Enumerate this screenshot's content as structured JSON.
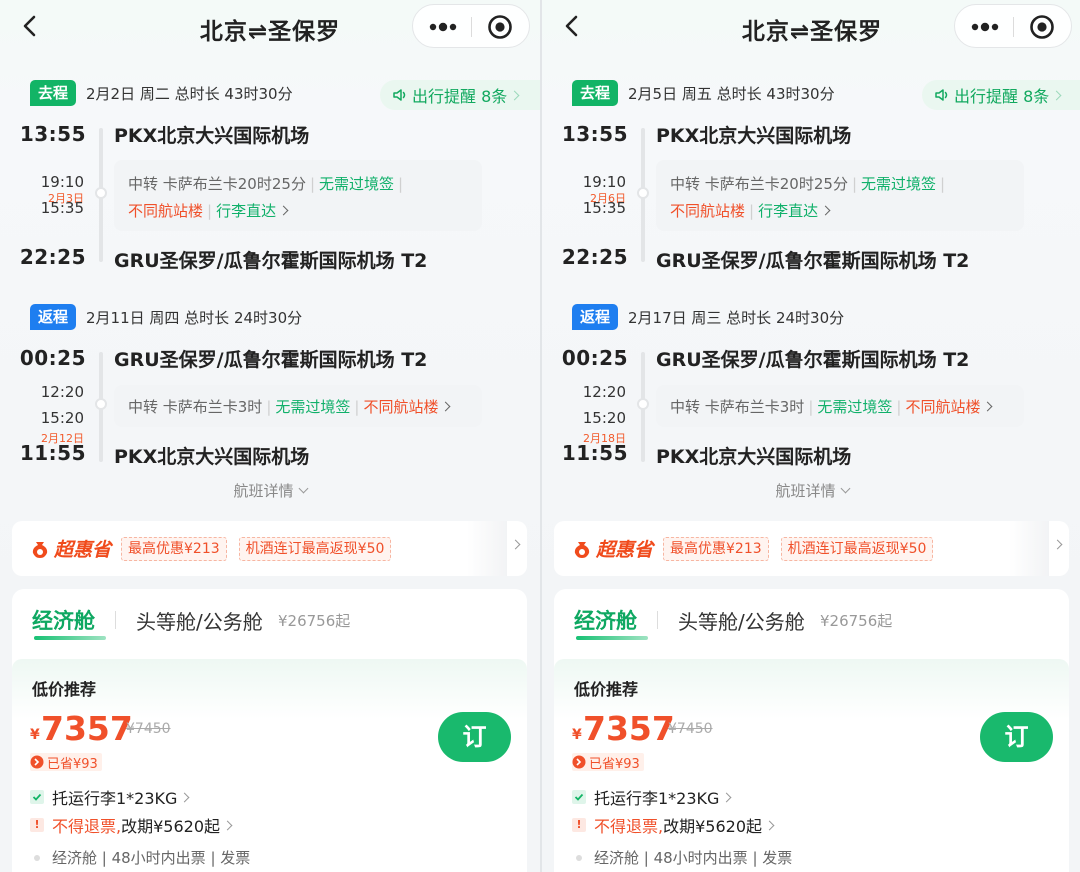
{
  "panels": [
    {
      "header": {
        "title": "北京⇌圣保罗"
      },
      "reminder": "出行提醒 8条",
      "outbound": {
        "tag": "去程",
        "info": "2月2日  周二   总时长 43时30分",
        "depart_time": "13:55",
        "depart_airport": "PKX北京大兴国际机场",
        "transfer_arrive": "19:10",
        "transfer_date": "2月3日",
        "transfer_depart": "15:35",
        "transfer_line1": "中转 卡萨布兰卡20时25分",
        "transfer_tag1": "无需过境签",
        "transfer_tag2": "不同航站楼",
        "transfer_tag3": "行李直达",
        "arrive_time": "22:25",
        "arrive_airport": "GRU圣保罗/瓜鲁尔霍斯国际机场 T2"
      },
      "inbound": {
        "tag": "返程",
        "info": "2月11日  周四   总时长 24时30分",
        "depart_time": "00:25",
        "depart_airport": "GRU圣保罗/瓜鲁尔霍斯国际机场 T2",
        "transfer_arrive": "12:20",
        "transfer_depart": "15:20",
        "transfer_line1": "中转 卡萨布兰卡3时",
        "transfer_tag1": "无需过境签",
        "transfer_tag2": "不同航站楼",
        "arrive_date": "2月12日",
        "arrive_time": "11:55",
        "arrive_airport": "PKX北京大兴国际机场"
      },
      "detail_link": "航班详情",
      "promo": {
        "logo": "超惠省",
        "coupon1": "最高优惠¥213",
        "coupon2": "机酒连订最高返现¥50"
      },
      "fares": {
        "tab_economy": "经济舱",
        "tab_first": "头等舱/公务舱",
        "tab_first_price": "¥26756起",
        "card_tag": "低价推荐",
        "currency": "¥",
        "price": "7357",
        "price_old": "¥7450",
        "saved": "已省¥93",
        "book": "订",
        "feature1": "托运行李1*23KG",
        "feature2_red": "不得退票,",
        "feature2_rest": "改期¥5620起",
        "feature3": "经济舱 | 48小时内出票 | 发票"
      }
    },
    {
      "header": {
        "title": "北京⇌圣保罗"
      },
      "reminder": "出行提醒 8条",
      "outbound": {
        "tag": "去程",
        "info": "2月5日  周五   总时长 43时30分",
        "depart_time": "13:55",
        "depart_airport": "PKX北京大兴国际机场",
        "transfer_arrive": "19:10",
        "transfer_date": "2月6日",
        "transfer_depart": "15:35",
        "transfer_line1": "中转 卡萨布兰卡20时25分",
        "transfer_tag1": "无需过境签",
        "transfer_tag2": "不同航站楼",
        "transfer_tag3": "行李直达",
        "arrive_time": "22:25",
        "arrive_airport": "GRU圣保罗/瓜鲁尔霍斯国际机场 T2"
      },
      "inbound": {
        "tag": "返程",
        "info": "2月17日  周三   总时长 24时30分",
        "depart_time": "00:25",
        "depart_airport": "GRU圣保罗/瓜鲁尔霍斯国际机场 T2",
        "transfer_arrive": "12:20",
        "transfer_depart": "15:20",
        "transfer_line1": "中转 卡萨布兰卡3时",
        "transfer_tag1": "无需过境签",
        "transfer_tag2": "不同航站楼",
        "arrive_date": "2月18日",
        "arrive_time": "11:55",
        "arrive_airport": "PKX北京大兴国际机场"
      },
      "detail_link": "航班详情",
      "promo": {
        "logo": "超惠省",
        "coupon1": "最高优惠¥213",
        "coupon2": "机酒连订最高返现¥50"
      },
      "fares": {
        "tab_economy": "经济舱",
        "tab_first": "头等舱/公务舱",
        "tab_first_price": "¥26756起",
        "card_tag": "低价推荐",
        "currency": "¥",
        "price": "7357",
        "price_old": "¥7450",
        "saved": "已省¥93",
        "book": "订",
        "feature1": "托运行李1*23KG",
        "feature2_red": "不得退票,",
        "feature2_rest": "改期¥5620起",
        "feature3": "经济舱 | 48小时内出票 | 发票"
      }
    }
  ],
  "colors": {
    "green": "#12b466",
    "blue": "#1e7ef0",
    "red": "#f0502a"
  },
  "icons": [
    "back-arrow-icon",
    "more-dots-icon",
    "mini-program-close-icon",
    "speaker-icon",
    "coin-icon",
    "check-icon",
    "exclamation-icon",
    "chevron-right-icon",
    "chevron-down-icon"
  ]
}
